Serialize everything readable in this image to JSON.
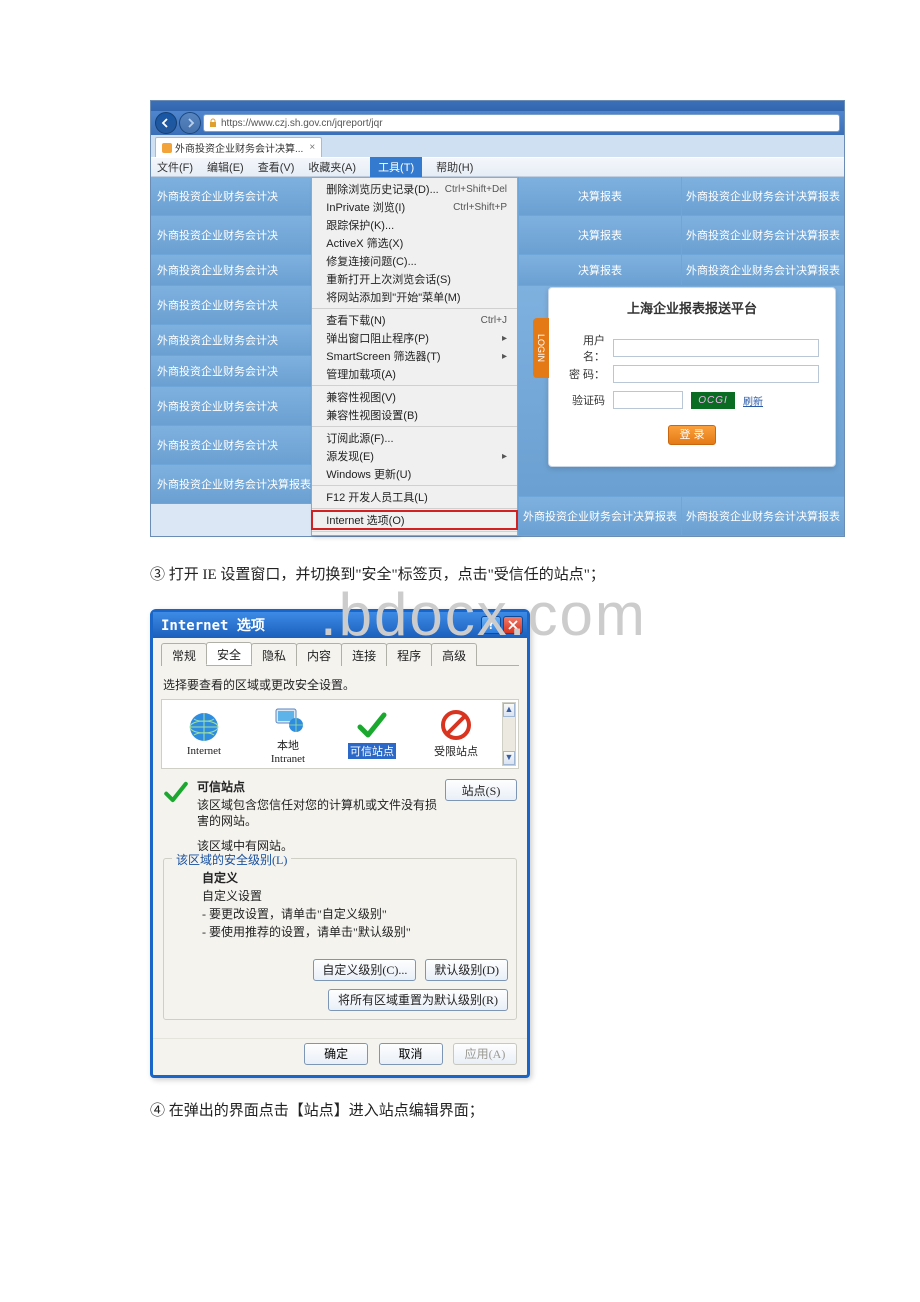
{
  "watermark": ".bdocx.com",
  "ie": {
    "url": "https://www.czj.sh.gov.cn/jqreport/jqr",
    "tab_title": "外商投资企业财务会计决算...",
    "tab_close": "×",
    "menu": {
      "file": "文件(F)",
      "edit": "编辑(E)",
      "view": "查看(V)",
      "favorites": "收藏夹(A)",
      "tools": "工具(T)",
      "help": "帮助(H)"
    },
    "left_row_text": "外商投资企业财务会计决",
    "left_row_text_cut": "外商投资企业财务会计决算报表",
    "dropdown": {
      "s1": [
        {
          "label": "删除浏览历史记录(D)...",
          "shortcut": "Ctrl+Shift+Del"
        },
        {
          "label": "InPrivate 浏览(I)",
          "shortcut": "Ctrl+Shift+P"
        },
        {
          "label": "跟踪保护(K)...",
          "shortcut": ""
        },
        {
          "label": "ActiveX 筛选(X)",
          "shortcut": ""
        },
        {
          "label": "修复连接问题(C)...",
          "shortcut": ""
        },
        {
          "label": "重新打开上次浏览会话(S)",
          "shortcut": ""
        },
        {
          "label": "将网站添加到\"开始\"菜单(M)",
          "shortcut": ""
        }
      ],
      "s2": [
        {
          "label": "查看下载(N)",
          "shortcut": "Ctrl+J"
        },
        {
          "label": "弹出窗口阻止程序(P)",
          "shortcut": "",
          "arrow": "▸"
        },
        {
          "label": "SmartScreen 筛选器(T)",
          "shortcut": "",
          "arrow": "▸"
        },
        {
          "label": "管理加载项(A)",
          "shortcut": ""
        }
      ],
      "s3": [
        {
          "label": "兼容性视图(V)",
          "shortcut": ""
        },
        {
          "label": "兼容性视图设置(B)",
          "shortcut": ""
        }
      ],
      "s4": [
        {
          "label": "订阅此源(F)...",
          "shortcut": ""
        },
        {
          "label": "源发现(E)",
          "shortcut": "",
          "arrow": "▸"
        },
        {
          "label": "Windows 更新(U)",
          "shortcut": ""
        }
      ],
      "s5": [
        {
          "label": "F12 开发人员工具(L)",
          "shortcut": ""
        }
      ],
      "s6": [
        {
          "label": "Internet 选项(O)",
          "shortcut": "",
          "highlighted": true
        }
      ]
    },
    "right_cells": {
      "c1": "决算报表",
      "c2": "外商投资企业财务会计决算报表",
      "c3": "外商投资企业财务会计决算报表"
    },
    "login": {
      "title": "上海企业报表报送平台",
      "side": "LOGIN",
      "user_label": "用户名：",
      "pw_label": "密  码：",
      "captcha_label": "验证码",
      "captcha_val": "OCGI",
      "refresh": "刷新",
      "button": "登 录"
    }
  },
  "step3": "③ 打开 IE 设置窗口，并切换到\"安全\"标签页，点击\"受信任的站点\"；",
  "step4": "④ 在弹出的界面点击【站点】进入站点编辑界面；",
  "dlg": {
    "title": "Internet 选项",
    "tabs": [
      "常规",
      "安全",
      "隐私",
      "内容",
      "连接",
      "程序",
      "高级"
    ],
    "zone_prompt": "选择要查看的区域或更改安全设置。",
    "zones": {
      "internet": "Internet",
      "intranet": "本地\nIntranet",
      "trusted": "可信站点",
      "restricted": "受限站点"
    },
    "zone_title": "可信站点",
    "zone_desc": "该区域包含您信任对您的计算机或文件没有损害的网站。",
    "zone_hassite": "该区域中有网站。",
    "sites_btn": "站点(S)",
    "group_title": "该区域的安全级别(L)",
    "custom_heading": "自定义",
    "custom_sub": "自定义设置",
    "custom_l1": "- 要更改设置，请单击\"自定义级别\"",
    "custom_l2": "- 要使用推荐的设置，请单击\"默认级别\"",
    "btn_custom": "自定义级别(C)...",
    "btn_default": "默认级别(D)",
    "btn_resetall": "将所有区域重置为默认级别(R)",
    "ok": "确定",
    "cancel": "取消",
    "apply": "应用(A)"
  }
}
